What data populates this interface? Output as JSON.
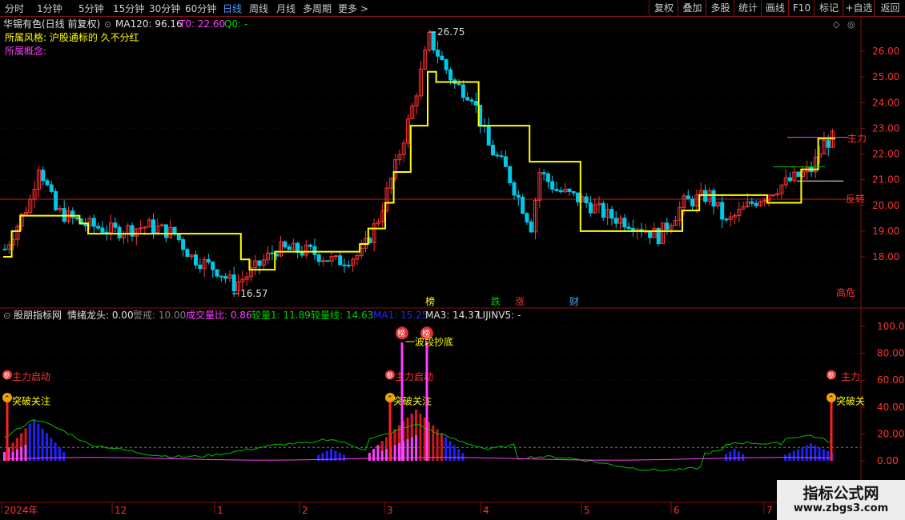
{
  "toolbar": {
    "periods": [
      "分时",
      "1分钟",
      "5分钟",
      "15分钟",
      "30分钟",
      "60分钟",
      "日线",
      "周线",
      "月线",
      "多周期",
      "更多 >"
    ],
    "active": "日线",
    "right_buttons": [
      "复权",
      "叠加",
      "多股",
      "统计",
      "画线",
      "F10",
      "标记",
      "+自选",
      "返回"
    ]
  },
  "header": {
    "stock": "华锡有色(日线 前复权)",
    "ma120": "MA120: 96.16",
    "t0": "T0: 22.60",
    "q0": "Q0: -"
  },
  "info": {
    "style": "所属风格:  沪股通标的 久不分红",
    "concept": "所属概念:"
  },
  "price_axis": {
    "ticks": [
      "26.00",
      "25.00",
      "24.00",
      "23.00",
      "22.00",
      "21.00",
      "20.00",
      "19.00",
      "18.00"
    ]
  },
  "price_annotations": {
    "high": "26.75",
    "low": "16.57",
    "zhuli": "主力",
    "fanyi": "反转",
    "gaowei": "高危"
  },
  "event_markers": [
    "榜",
    "跌",
    "涨",
    "财"
  ],
  "indicator_header": {
    "name": "股朋指标网",
    "qxlt": "情绪龙头: 0.00",
    "jj": "警戒: 10.00",
    "cjlb": "成交量比: 0.86",
    "jl1": "较量1: 11.89",
    "jlx": "较量线: 14.63",
    "ma1": "MA1: 15.25",
    "ma3": "MA3: 14.37",
    "lj": "LIJINV5: -"
  },
  "indicator_axis": {
    "ticks": [
      "100.00",
      "80.00",
      "60.00",
      "40.00",
      "20.00",
      "0.00"
    ]
  },
  "indicator_labels": {
    "zhuli_qidong": "主力启动",
    "tupo": "突破关注",
    "bang": "榜",
    "can": "参",
    "tupo_short": "突破关",
    "zhuli_short": "主力",
    "bottom_text": "一波段抄底"
  },
  "date_axis": {
    "labels": [
      "2024年",
      "12",
      "1",
      "2",
      "3",
      "4",
      "5",
      "6",
      "7"
    ]
  },
  "watermark": {
    "title": "指标公式网",
    "url": "www.zbgs3.com"
  },
  "colors": {
    "up": "#ff3232",
    "down": "#00c8e8",
    "yellow": "#ffff00",
    "magenta": "#ff40ff",
    "blue": "#2020ff",
    "green": "#00d000",
    "grid": "#8a1010"
  }
}
